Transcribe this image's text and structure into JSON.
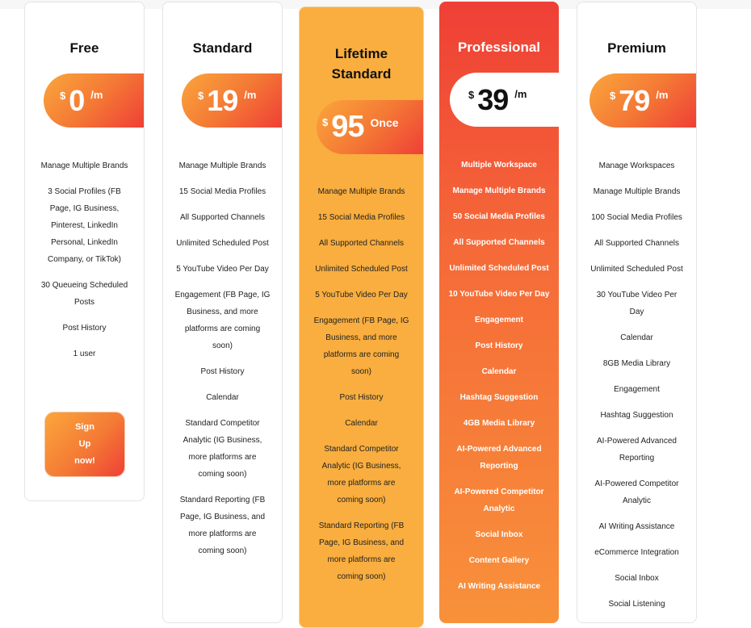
{
  "plans": [
    {
      "name": "Free",
      "currency": "$",
      "price": "0",
      "period": "/m",
      "features": [
        "Manage Multiple Brands",
        "3 Social Profiles (FB Page, IG Business, Pinterest, LinkedIn Personal, LinkedIn Company, or TikTok)",
        "30 Queueing Scheduled Posts",
        "Post History",
        "1 user"
      ],
      "cta": "Sign Up now!"
    },
    {
      "name": "Standard",
      "currency": "$",
      "price": "19",
      "period": "/m",
      "features": [
        "Manage Multiple Brands",
        "15 Social Media Profiles",
        "All Supported Channels",
        "Unlimited Scheduled Post",
        "5 YouTube Video Per Day",
        "Engagement (FB Page, IG Business, and more platforms are coming soon)",
        "Post History",
        "Calendar",
        "Standard Competitor Analytic (IG Business, more platforms are coming soon)",
        "Standard Reporting (FB Page, IG Business, and more platforms are coming soon)"
      ]
    },
    {
      "name": "Lifetime Standard",
      "currency": "$",
      "price": "95",
      "period": "Once",
      "features": [
        "Manage Multiple Brands",
        "15 Social Media Profiles",
        "All Supported Channels",
        "Unlimited Scheduled Post",
        "5 YouTube Video Per Day",
        "Engagement (FB Page, IG Business, and more platforms are coming soon)",
        "Post History",
        "Calendar",
        "Standard Competitor Analytic (IG Business, more platforms are coming soon)",
        "Standard Reporting (FB Page, IG Business, and more platforms are coming soon)"
      ]
    },
    {
      "name": "Professional",
      "currency": "$",
      "price": "39",
      "period": "/m",
      "features": [
        "Multiple Workspace",
        "Manage Multiple Brands",
        "50 Social Media Profiles",
        "All Supported Channels",
        "Unlimited Scheduled Post",
        "10 YouTube Video Per Day",
        "Engagement",
        "Post History",
        "Calendar",
        "Hashtag Suggestion",
        "4GB Media Library",
        "AI-Powered Advanced Reporting",
        "AI-Powered Competitor Analytic",
        "Social Inbox",
        "Content Gallery",
        "AI Writing Assistance"
      ]
    },
    {
      "name": "Premium",
      "currency": "$",
      "price": "79",
      "period": "/m",
      "features": [
        "Manage Workspaces",
        "Manage Multiple Brands",
        "100 Social Media Profiles",
        "All Supported Channels",
        "Unlimited Scheduled Post",
        "30 YouTube Video Per Day",
        "Calendar",
        "8GB Media Library",
        "Engagement",
        "Hashtag Suggestion",
        "AI-Powered Advanced Reporting",
        "AI-Powered Competitor Analytic",
        "AI Writing Assistance",
        "eCommerce Integration",
        "Social Inbox",
        "Social Listening"
      ]
    }
  ],
  "colors": {
    "accent_orange": "#F9AE3F",
    "accent_red": "#EF3F36"
  }
}
